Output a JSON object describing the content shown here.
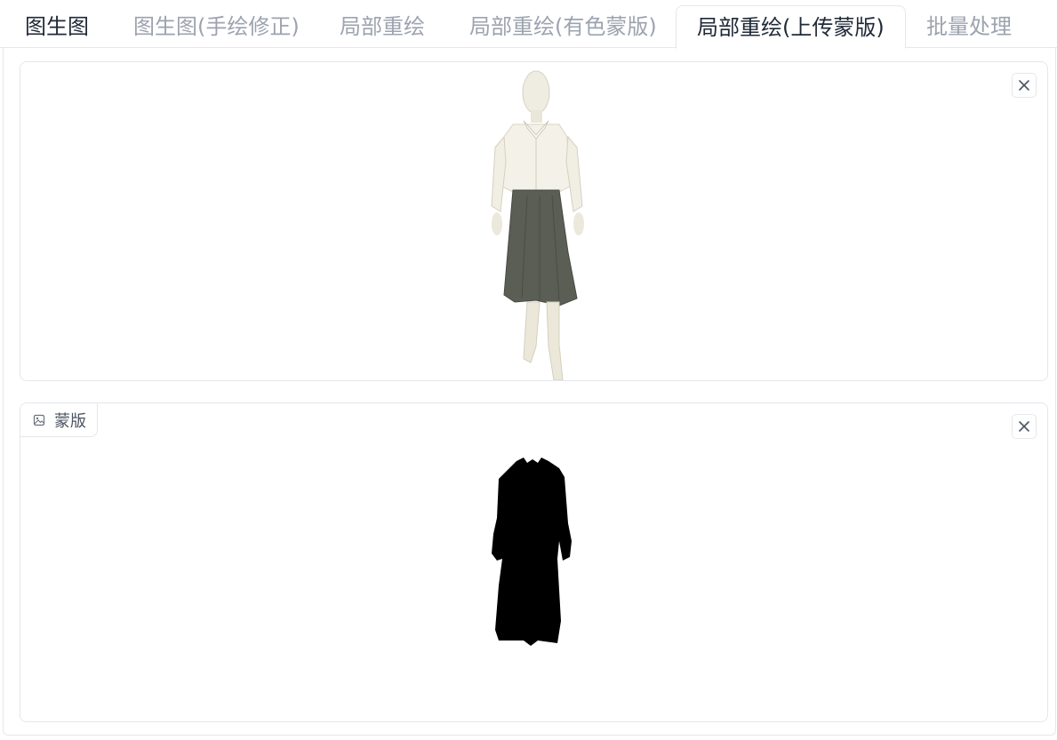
{
  "tabs": [
    {
      "label": "图生图"
    },
    {
      "label": "图生图(手绘修正)"
    },
    {
      "label": "局部重绘"
    },
    {
      "label": "局部重绘(有色蒙版)"
    },
    {
      "label": "局部重绘(上传蒙版)"
    },
    {
      "label": "批量处理"
    }
  ],
  "active_tab": "局部重绘(上传蒙版)",
  "mask_box": {
    "label": "蒙版",
    "icon": "image-icon"
  },
  "colors": {
    "active_text": "#1f2937",
    "inactive_text": "#9ca3af",
    "border": "#e5e7eb",
    "mask": "#000000"
  }
}
